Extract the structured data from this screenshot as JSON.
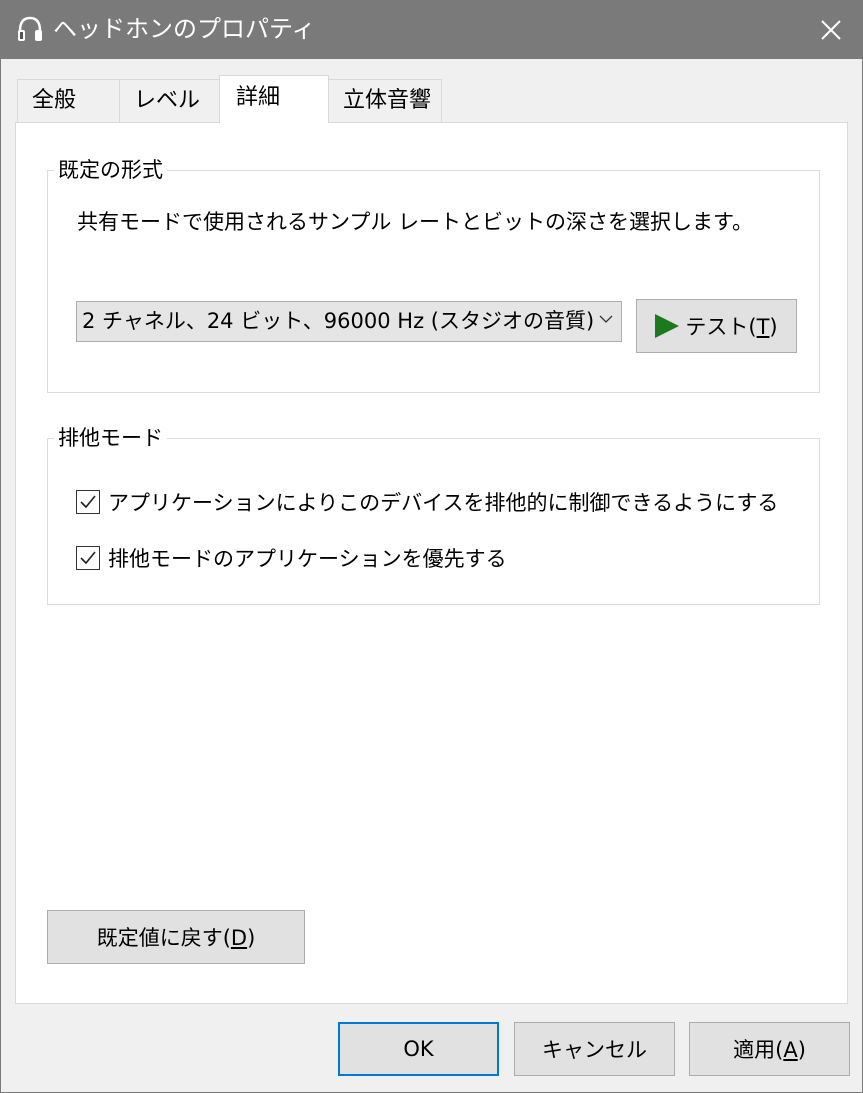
{
  "window": {
    "title": "ヘッドホンのプロパティ"
  },
  "tabs": [
    {
      "label": "全般"
    },
    {
      "label": "レベル"
    },
    {
      "label": "詳細"
    },
    {
      "label": "立体音響"
    }
  ],
  "default_format": {
    "group_label": "既定の形式",
    "description": "共有モードで使用されるサンプル レートとビットの深さを選択します。",
    "selected_format": "2 チャネル、24 ビット、96000 Hz (スタジオの音質)",
    "test_label": "テスト(",
    "test_key": "T",
    "test_close": ")"
  },
  "exclusive_mode": {
    "group_label": "排他モード",
    "options": [
      {
        "label": "アプリケーションによりこのデバイスを排他的に制御できるようにする",
        "checked": true
      },
      {
        "label": "排他モードのアプリケーションを優先する",
        "checked": true
      }
    ]
  },
  "reset": {
    "label": "既定値に戻す(",
    "key": "D",
    "close": ")"
  },
  "buttons": {
    "ok": "OK",
    "cancel": "キャンセル",
    "apply_label": "適用(",
    "apply_key": "A",
    "apply_close": ")"
  },
  "colors": {
    "titlebar": "#7a7a7a",
    "accent": "#0078d7",
    "play_icon": "#1c7a1c"
  }
}
